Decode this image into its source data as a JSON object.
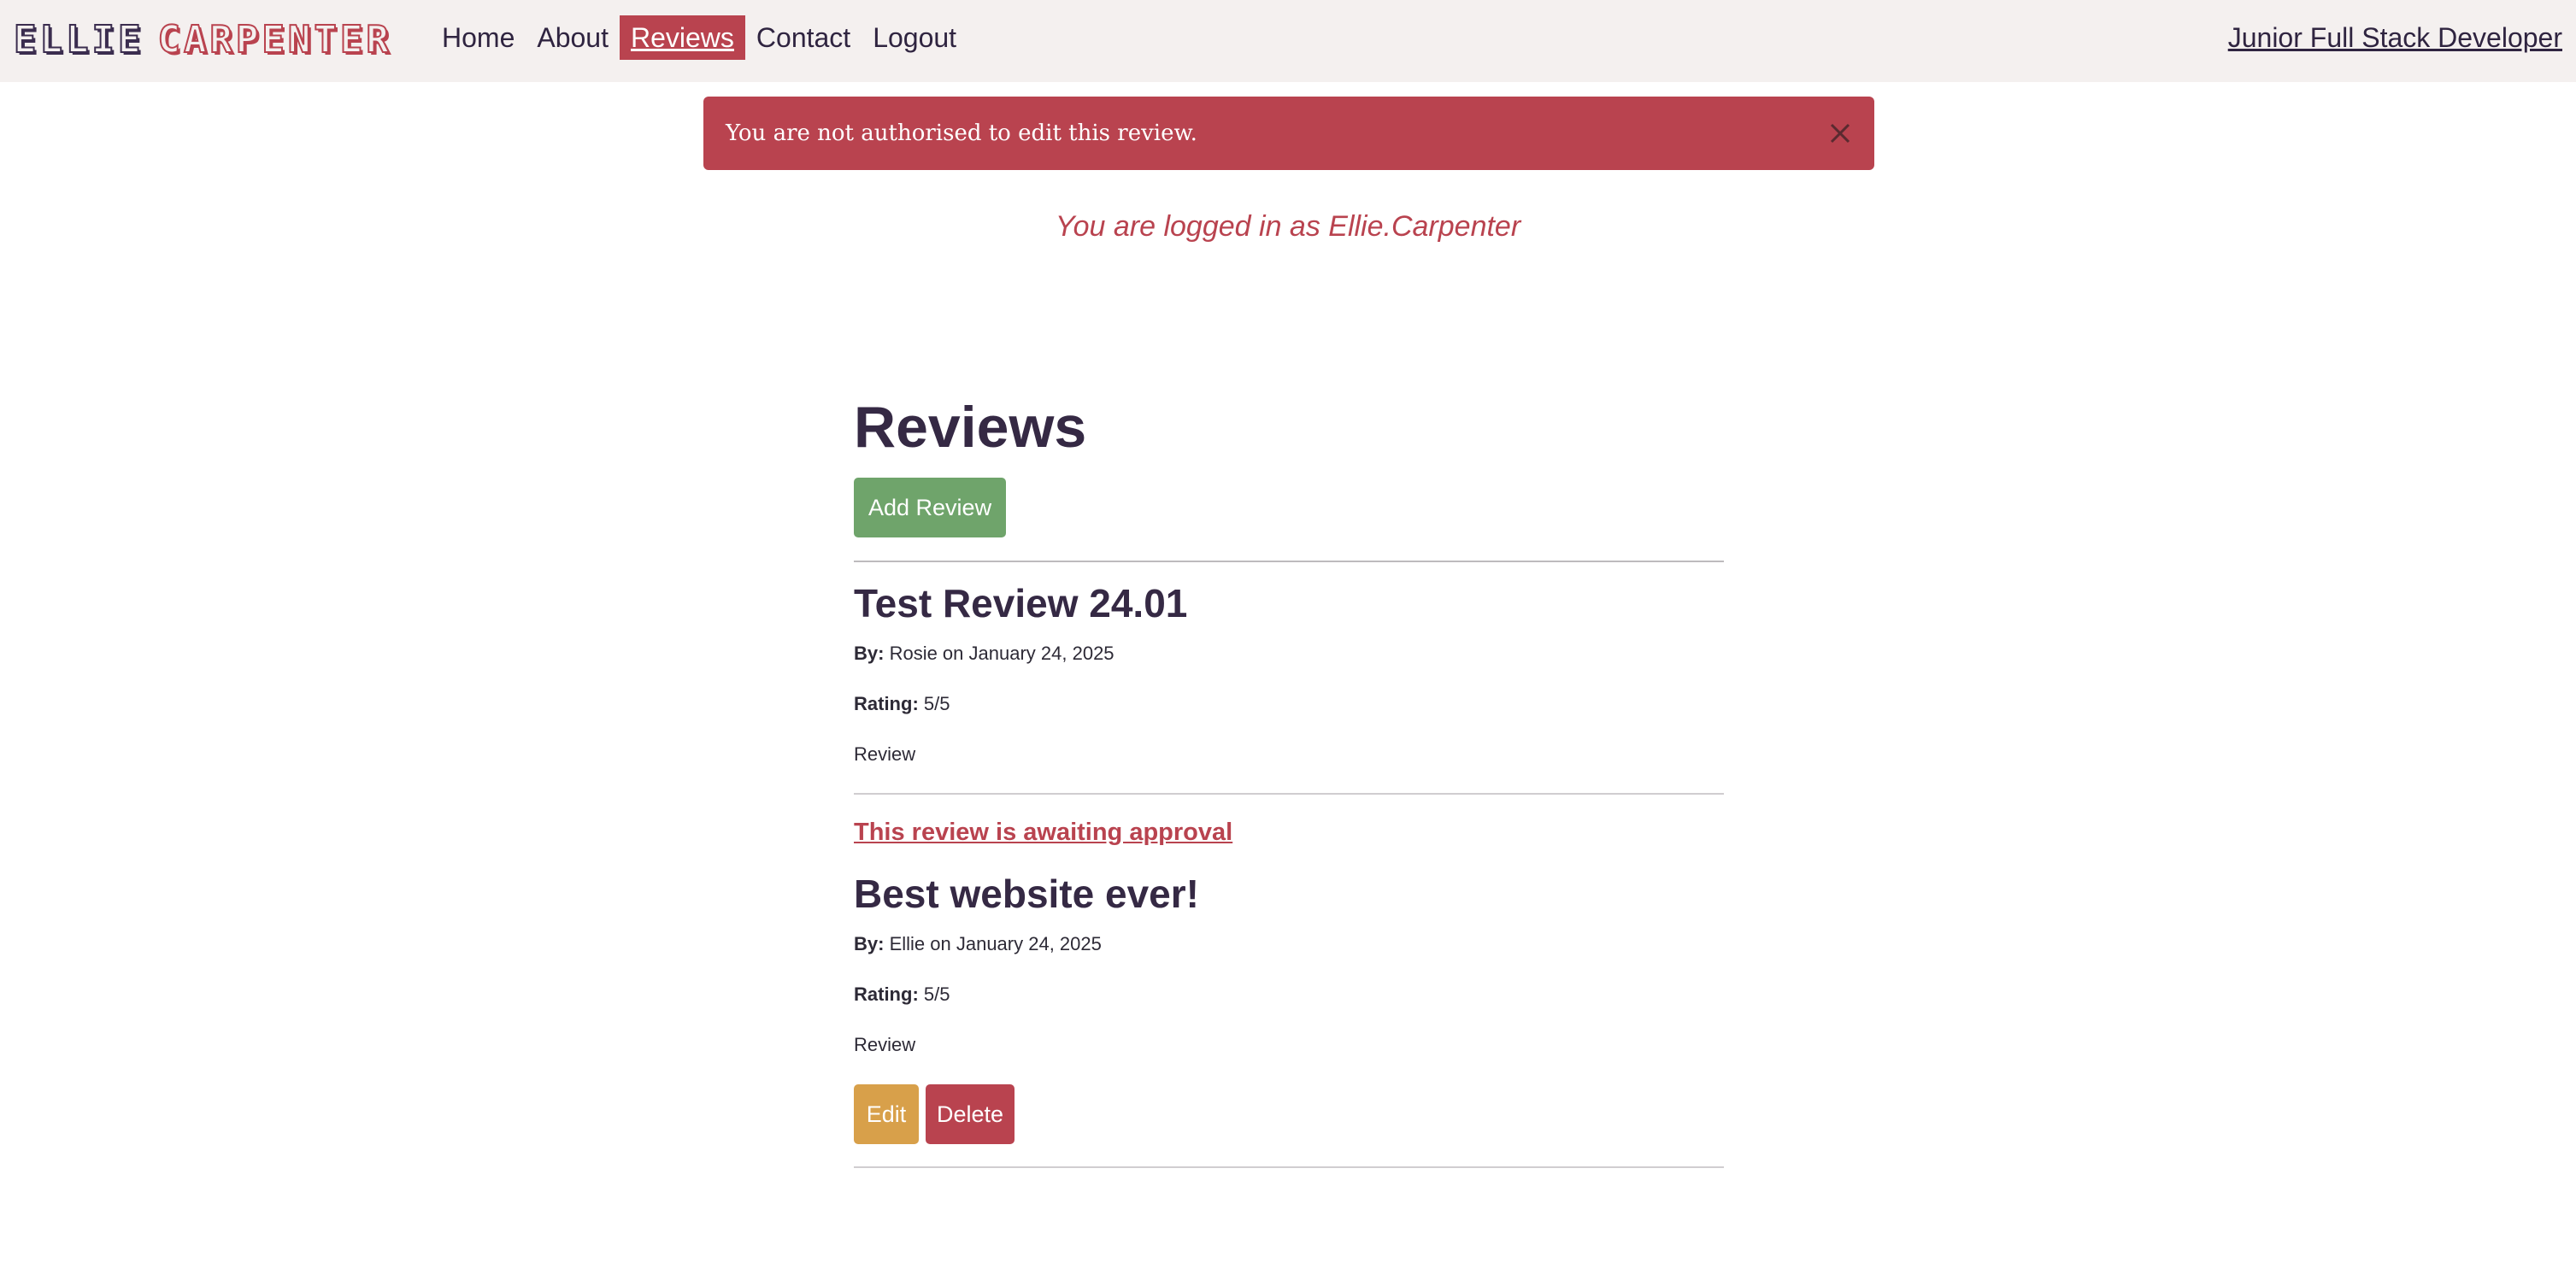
{
  "brand": {
    "first": "ELLIE",
    "last": "CARPENTER"
  },
  "nav": {
    "items": [
      {
        "label": "Home",
        "active": false
      },
      {
        "label": "About",
        "active": false
      },
      {
        "label": "Reviews",
        "active": true
      },
      {
        "label": "Contact",
        "active": false
      },
      {
        "label": "Logout",
        "active": false
      }
    ],
    "tagline": "Junior Full Stack Developer"
  },
  "alert": {
    "message": "You are not authorised to edit this review.",
    "close_icon": "close-icon"
  },
  "logged_in_text": "You are logged in as Ellie.Carpenter",
  "page": {
    "title": "Reviews",
    "add_button": "Add Review"
  },
  "reviews": [
    {
      "title": "Test Review 24.01",
      "by_label": "By:",
      "by_text": "Rosie on January 24, 2025",
      "rating_label": "Rating:",
      "rating_text": "5/5",
      "body": "Review"
    },
    {
      "pending": "This review is awaiting approval",
      "title": "Best website ever!",
      "by_label": "By:",
      "by_text": "Ellie on January 24, 2025",
      "rating_label": "Rating:",
      "rating_text": "5/5",
      "body": "Review",
      "edit_label": "Edit",
      "delete_label": "Delete"
    }
  ],
  "colors": {
    "accent": "#b9434f",
    "brand_dark": "#352944",
    "add_button": "#6fa46b",
    "edit_button": "#d8a04a",
    "navbar_bg": "#f4f0ef"
  }
}
